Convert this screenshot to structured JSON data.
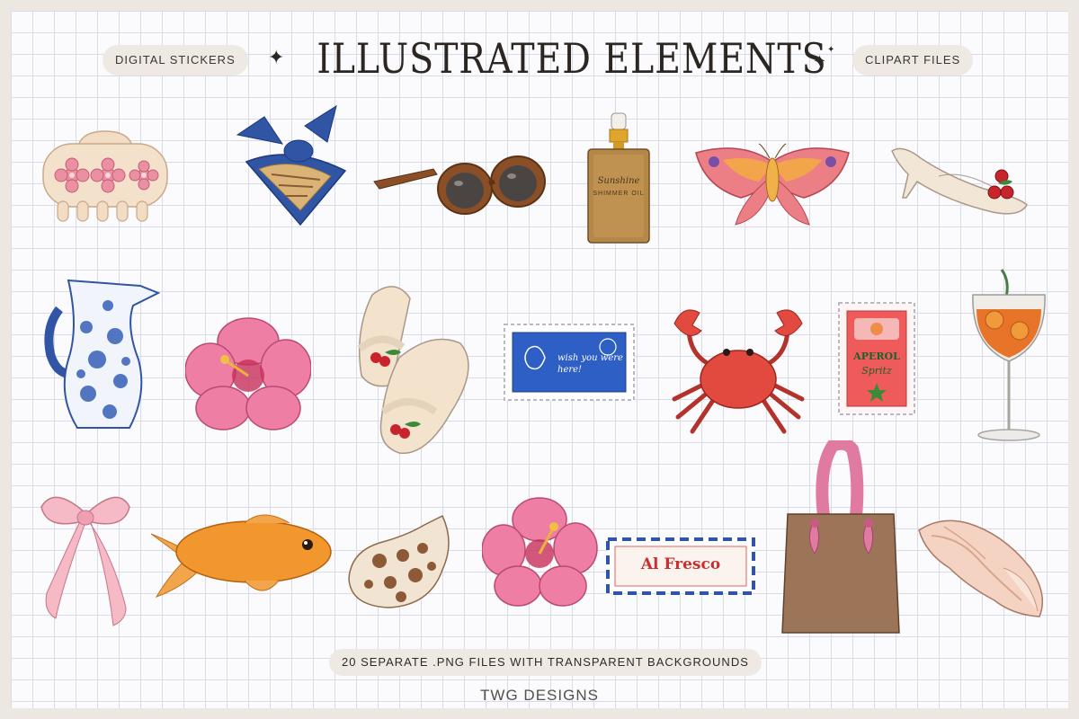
{
  "header": {
    "left_badge": "DIGITAL STICKERS",
    "title": "ILLUSTRATED ELEMENTS",
    "right_badge": "CLIPART FILES"
  },
  "footer": {
    "files_note": "20 SEPARATE .PNG FILES WITH TRANSPARENT BACKGROUNDS",
    "brand": "TWG DESIGNS"
  },
  "stickers": {
    "oil_label": "Sunshine",
    "oil_sub": "SHIMMER OIL",
    "postcard_text": "wish you were here!",
    "aperol_line1": "APEROL",
    "aperol_line2": "Spritz",
    "al_fresco": "Al Fresco"
  },
  "colors": {
    "background": "#fbfbfd",
    "grid_line": "#d9dbe6",
    "pill_bg": "#eeeae3",
    "text_dark": "#2b2622"
  }
}
